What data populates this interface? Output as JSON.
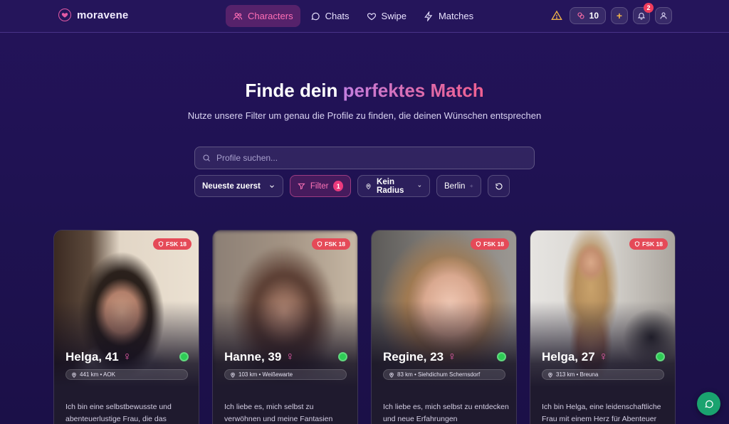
{
  "brand": {
    "name": "moravene"
  },
  "nav": {
    "items": [
      {
        "label": "Characters",
        "icon": "users-icon",
        "active": true
      },
      {
        "label": "Chats",
        "icon": "chat-bubble-icon",
        "active": false
      },
      {
        "label": "Swipe",
        "icon": "heart-icon",
        "active": false
      },
      {
        "label": "Matches",
        "icon": "lightning-icon",
        "active": false
      }
    ],
    "tokens": "10",
    "notifications_count": "2"
  },
  "hero": {
    "title_prefix": "Finde dein",
    "title_accent": "perfektes Match",
    "subtitle": "Nutze unsere Filter um genau die Profile zu finden, die deinen Wünschen entsprechen"
  },
  "search": {
    "placeholder": "Profile suchen..."
  },
  "filters": {
    "sort_label": "Neueste zuerst",
    "filter_label": "Filter",
    "filter_count": "1",
    "radius_label": "Kein Radius",
    "city_label": "Berlin"
  },
  "cards": [
    {
      "badge": "FSK 18",
      "name": "Helga, 41",
      "gender": "♀",
      "location": "441 km • AOK",
      "description": "Ich bin eine selbstbewusste und abenteuerlustige Frau, die das",
      "online": true
    },
    {
      "badge": "FSK 18",
      "name": "Hanne, 39",
      "gender": "♀",
      "location": "103 km • Weißewarte",
      "description": "Ich liebe es, mich selbst zu verwöhnen und meine Fantasien",
      "online": true
    },
    {
      "badge": "FSK 18",
      "name": "Regine, 23",
      "gender": "♀",
      "location": "83 km • Siehdichum Schernsdorf",
      "description": "Ich liebe es, mich selbst zu entdecken und neue Erfahrungen",
      "online": true
    },
    {
      "badge": "FSK 18",
      "name": "Helga, 27",
      "gender": "♀",
      "location": "313 km • Breuna",
      "description": "Ich bin Helga, eine leidenschaftliche Frau mit einem Herz für Abenteuer",
      "online": true
    }
  ],
  "colors": {
    "accent_pink": "#ff6fb5",
    "online_green": "#2ecc55",
    "fsk_red": "#e54a58",
    "fab_green": "#1aa36f"
  }
}
